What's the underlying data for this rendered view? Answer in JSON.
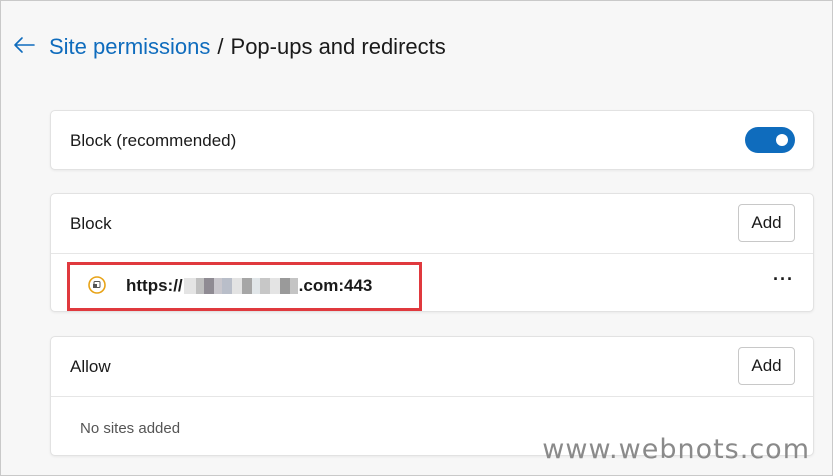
{
  "header": {
    "back_icon": "arrow-left-icon",
    "breadcrumb_parent": "Site permissions",
    "separator": "/",
    "breadcrumb_current": "Pop-ups and redirects"
  },
  "block_toggle": {
    "label": "Block (recommended)",
    "enabled": true
  },
  "block_section": {
    "title": "Block",
    "add_label": "Add",
    "sites": [
      {
        "icon": "site-info-icon",
        "url_prefix": "https://",
        "url_suffix": ".com:443",
        "more_label": "···"
      }
    ]
  },
  "allow_section": {
    "title": "Allow",
    "add_label": "Add",
    "empty_text": "No sites added"
  },
  "watermark": "www.webnots.com",
  "colors": {
    "accent": "#0f6cbd",
    "highlight_border": "#e0393e",
    "site_icon": "#e8a317"
  }
}
